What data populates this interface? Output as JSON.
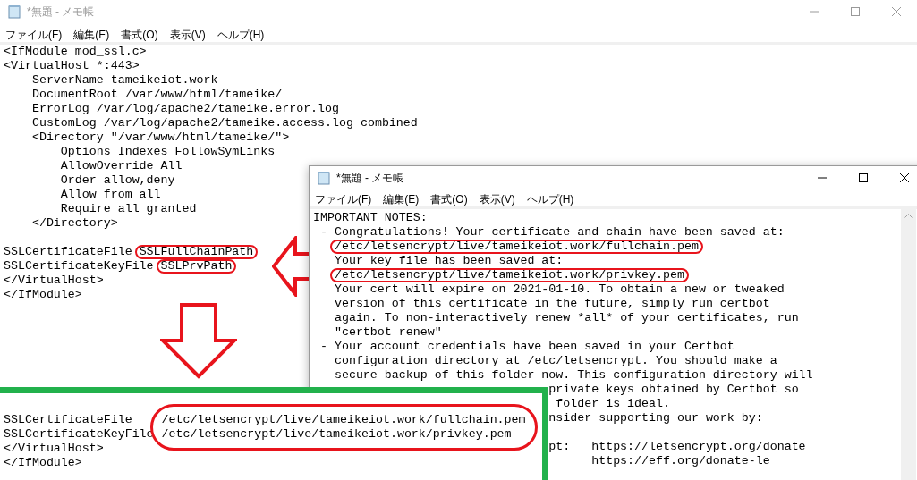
{
  "windows": [
    {
      "title": "*無題 - メモ帳",
      "active": false,
      "menu": [
        "ファイル(F)",
        "編集(E)",
        "書式(O)",
        "表示(V)",
        "ヘルプ(H)"
      ],
      "blocks": [
        [
          {
            "text": "<IfModule mod_ssl.c>",
            "circled": false
          },
          {
            "text": "<VirtualHost *:443>",
            "circled": false
          },
          {
            "text": "    ServerName tameikeiot.work",
            "circled": false
          },
          {
            "text": "    DocumentRoot /var/www/html/tameike/",
            "circled": false
          },
          {
            "text": "    ErrorLog /var/log/apache2/tameike.error.log",
            "circled": false
          },
          {
            "text": "    CustomLog /var/log/apache2/tameike.access.log combined",
            "circled": false
          },
          {
            "text": "    <Directory \"/var/www/html/tameike/\">",
            "circled": false
          },
          {
            "text": "        Options Indexes FollowSymLinks",
            "circled": false
          },
          {
            "text": "        AllowOverride All",
            "circled": false
          },
          {
            "text": "        Order allow,deny",
            "circled": false
          },
          {
            "text": "        Allow from all",
            "circled": false
          },
          {
            "text": "        Require all granted",
            "circled": false
          },
          {
            "text": "    </Directory>",
            "circled": false
          }
        ],
        [
          {
            "text": "SSLCertificateFile",
            "value": "SSLFullChainPath",
            "circled": true
          },
          {
            "text": "SSLCertificateKeyFile",
            "value": "SSLPrvPath",
            "circled": true
          },
          {
            "text": "</VirtualHost>",
            "circled": false
          },
          {
            "text": "</IfModule>",
            "circled": false
          }
        ]
      ]
    },
    {
      "title": "*無題 - メモ帳",
      "active": true,
      "menu": [
        "ファイル(F)",
        "編集(E)",
        "書式(O)",
        "表示(V)",
        "ヘルプ(H)"
      ],
      "blocks": [
        [
          {
            "text": "IMPORTANT NOTES:",
            "circled": false
          },
          {
            "text": " - Congratulations! Your certificate and chain have been saved at:",
            "circled": false
          },
          {
            "text": "   /etc/letsencrypt/live/tameikeiot.work/fullchain.pem",
            "circled": true
          },
          {
            "text": "   Your key file has been saved at:",
            "circled": false
          },
          {
            "text": "   /etc/letsencrypt/live/tameikeiot.work/privkey.pem",
            "circled": true
          },
          {
            "text": "   Your cert will expire on 2021-01-10. To obtain a new or tweaked",
            "circled": false
          },
          {
            "text": "   version of this certificate in the future, simply run certbot",
            "circled": false
          },
          {
            "text": "   again. To non-interactively renew *all* of your certificates, run",
            "circled": false
          },
          {
            "text": "   \"certbot renew\"",
            "circled": false
          },
          {
            "text": " - Your account credentials have been saved in your Certbot",
            "circled": false
          },
          {
            "text": "   configuration directory at /etc/letsencrypt. You should make a",
            "circled": false
          },
          {
            "text": "   secure backup of this folder now. This configuration directory will",
            "circled": false
          },
          {
            "text": "                                 private keys obtained by Certbot so",
            "circled": false
          },
          {
            "text": "                                  folder is ideal.",
            "circled": false
          },
          {
            "text": "                                 nsider supporting our work by:",
            "circled": false
          }
        ],
        [
          {
            "text": "                                 pt:   https://letsencrypt.org/donate",
            "circled": false
          },
          {
            "text": "                                       https://eff.org/donate-le",
            "circled": false
          }
        ]
      ]
    }
  ],
  "edited_panel": {
    "circled": true,
    "rows": [
      {
        "key": "SSLCertificateFile",
        "value": "/etc/letsencrypt/live/tameikeiot.work/fullchain.pem"
      },
      {
        "key": "SSLCertificateKeyFile",
        "value": "/etc/letsencrypt/live/tameikeiot.work/privkey.pem"
      }
    ],
    "trailing_lines": [
      "</VirtualHost>",
      "</IfModule>"
    ]
  }
}
